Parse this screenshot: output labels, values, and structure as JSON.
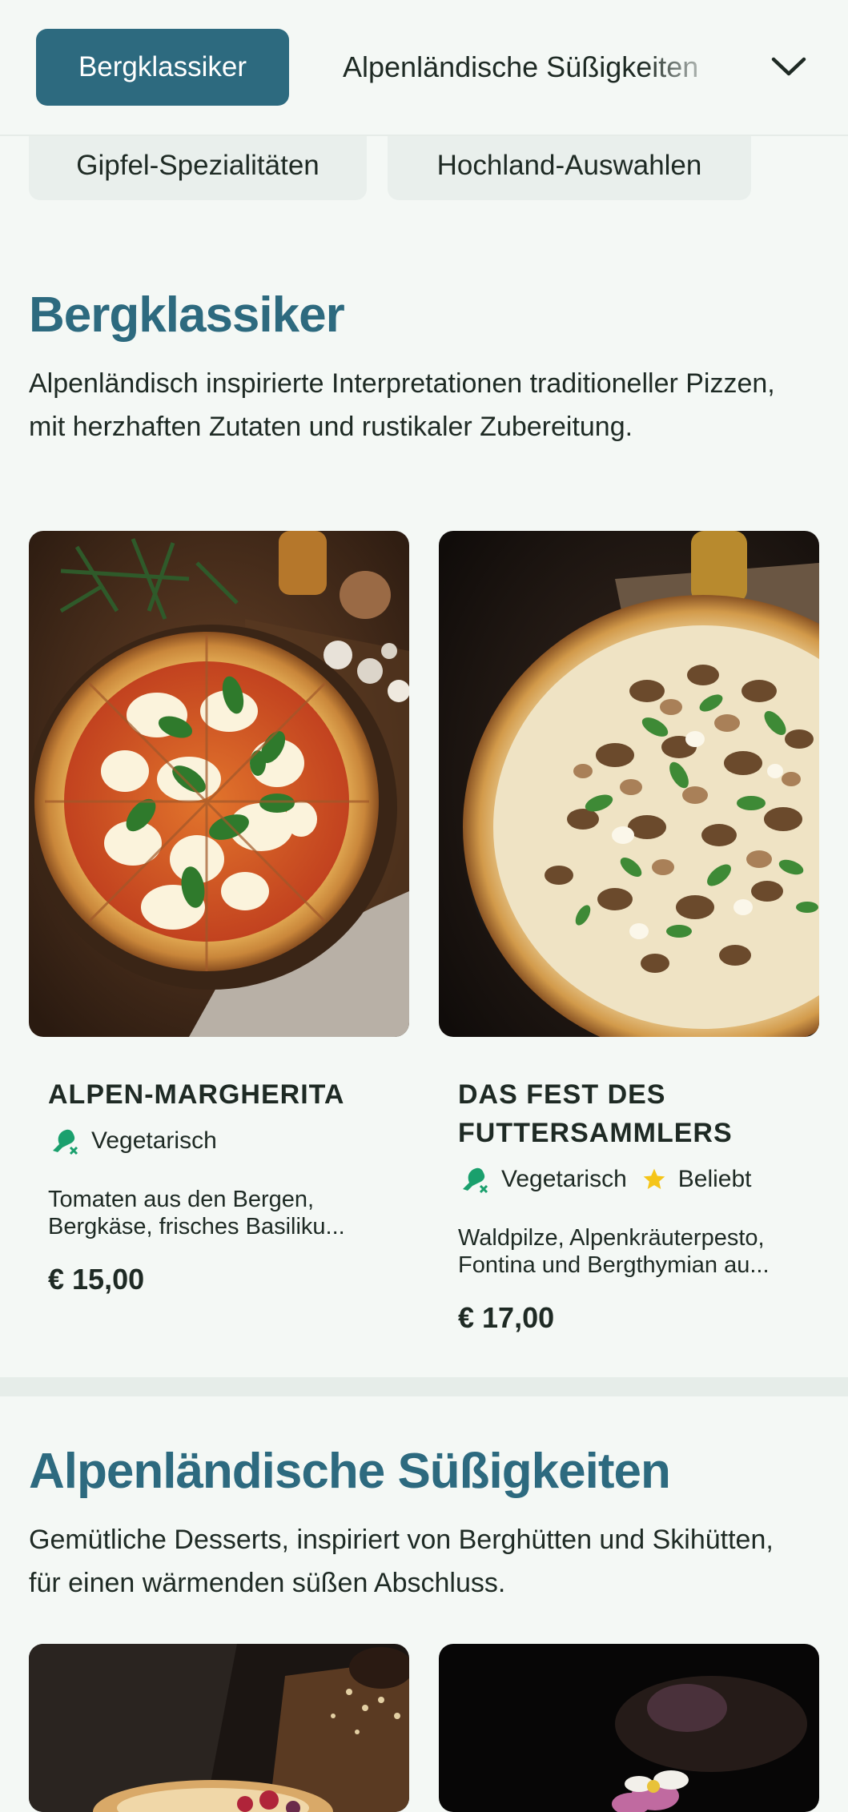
{
  "nav": {
    "active_tab": "Bergklassiker",
    "tab_2": "Alpenländische Süßigkeiten",
    "tab_3": "Gipfel-Spezialitäten",
    "tab_4": "Hochland-Auswahlen"
  },
  "sections": [
    {
      "title": "Bergklassiker",
      "description": "Alpenländisch inspirierte Interpretationen traditioneller Pizzen, mit herzhaften Zutaten und rustikaler Zubereitung.",
      "items": [
        {
          "name": "ALPEN-MARGHERITA",
          "tags": [
            "Vegetarisch"
          ],
          "description_line1": "Tomaten aus den Bergen,",
          "description_line2": "Bergkäse, frisches Basiliku...",
          "price": "€ 15,00"
        },
        {
          "name": "DAS FEST DES FUTTERSAMMLERS",
          "tags": [
            "Vegetarisch",
            "Beliebt"
          ],
          "description_line1": "Waldpilze, Alpenkräuterpesto,",
          "description_line2": "Fontina und Bergthymian au...",
          "price": "€ 17,00"
        }
      ]
    },
    {
      "title": "Alpenländische Süßigkeiten",
      "description": "Gemütliche Desserts, inspiriert von Berghütten und Skihütten, für einen wärmenden süßen Abschluss."
    }
  ],
  "icons": {
    "vegetarian": "drumstick-crossed-icon",
    "popular": "star-icon",
    "dropdown": "chevron-down-icon"
  },
  "colors": {
    "accent": "#2d6a7f",
    "vegetarian_icon": "#1aa06d",
    "popular_icon": "#f5c518",
    "background": "#f4f8f5"
  }
}
